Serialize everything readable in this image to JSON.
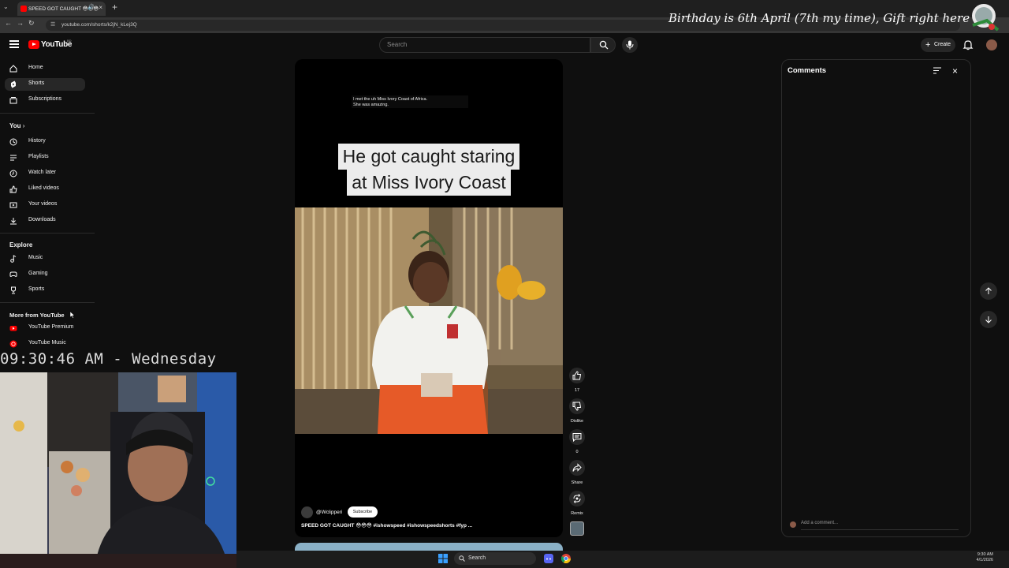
{
  "browser": {
    "tab_title": "SPEED GOT CAUGHT 😳😳😳",
    "url": "youtube.com/shorts/k2jN_kLej3Q"
  },
  "overlay": {
    "banner": "Birthday is 6th April (7th my time), Gift right here →",
    "clock": "09:30:46 AM - Wednesday"
  },
  "youtube": {
    "logo_text": "YouTube",
    "country_code": "BD",
    "search_placeholder": "Search",
    "create_label": "Create"
  },
  "sidebar": {
    "top_items": [
      {
        "label": "Home",
        "icon": "home-icon"
      },
      {
        "label": "Shorts",
        "icon": "shorts-icon",
        "active": true
      },
      {
        "label": "Subscriptions",
        "icon": "subscriptions-icon"
      }
    ],
    "you_header": "You",
    "you_items": [
      {
        "label": "History",
        "icon": "history-icon"
      },
      {
        "label": "Playlists",
        "icon": "playlists-icon"
      },
      {
        "label": "Watch later",
        "icon": "watch-later-icon"
      },
      {
        "label": "Liked videos",
        "icon": "liked-videos-icon"
      },
      {
        "label": "Your videos",
        "icon": "your-videos-icon"
      },
      {
        "label": "Downloads",
        "icon": "downloads-icon"
      }
    ],
    "explore_header": "Explore",
    "explore_items": [
      {
        "label": "Music",
        "icon": "music-icon"
      },
      {
        "label": "Gaming",
        "icon": "gaming-icon"
      },
      {
        "label": "Sports",
        "icon": "sports-icon"
      }
    ],
    "more_header": "More from YouTube",
    "more_items": [
      {
        "label": "YouTube Premium",
        "icon": "youtube-premium-icon"
      },
      {
        "label": "YouTube Music",
        "icon": "youtube-music-icon"
      }
    ]
  },
  "short": {
    "subtitle_line1": "I met the uh Miss Ivory Coast of Africa.",
    "subtitle_line2": "She was amazing.",
    "caption_line1": "He got caught staring",
    "caption_line2": "at Miss Ivory Coast",
    "channel": "@Wclipperi",
    "subscribe_label": "Subscribe",
    "title": "SPEED GOT CAUGHT 😳😳😳 #ishowspeed #ishowspeedshorts #fyp ..."
  },
  "actions": {
    "like_count": "17",
    "dislike_label": "Dislike",
    "comment_count": "0",
    "share_label": "Share",
    "remix_label": "Remix"
  },
  "comments": {
    "title": "Comments",
    "add_placeholder": "Add a comment..."
  },
  "taskbar": {
    "search_label": "Search",
    "time": "9:30 AM",
    "date": "4/1/2026"
  },
  "colors": {
    "youtube_red": "#ff0000",
    "background": "#0f0f0f",
    "caption_bg": "#ececec"
  }
}
